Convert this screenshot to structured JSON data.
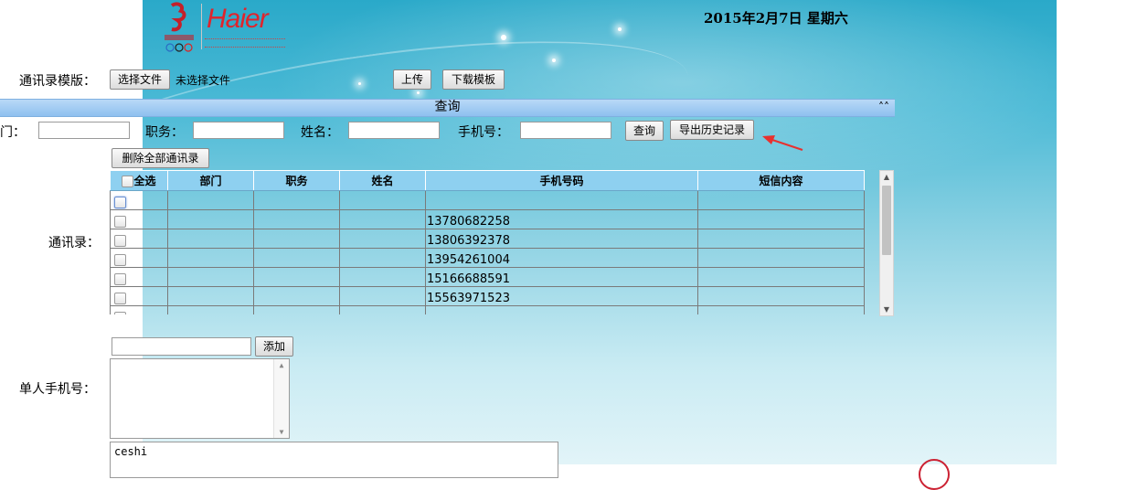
{
  "header": {
    "logo_text": "Haier",
    "logo_caption": "Beijing 2008",
    "date": "2015年2月7日   星期六"
  },
  "template_row": {
    "label": "通讯录模版：",
    "choose_file_button": "选择文件",
    "no_file_text": "未选择文件",
    "upload_button": "上传",
    "download_template_button": "下载模板"
  },
  "query": {
    "bar_title": "查询",
    "collapse_icon": "double-chevron-up",
    "department_label": "部门：",
    "department_value": "",
    "position_label": "职务：",
    "position_value": "",
    "name_label": "姓名：",
    "name_value": "",
    "phone_label": "手机号：",
    "phone_value": "",
    "search_button": "查询",
    "export_history_button": "导出历史记录"
  },
  "contacts": {
    "delete_all_button": "删除全部通讯录",
    "label": "通讯录：",
    "columns": [
      "全选",
      "部门",
      "职务",
      "姓名",
      "手机号码",
      "短信内容"
    ],
    "rows": [
      {
        "department": "",
        "position": "",
        "name": "",
        "phone": "",
        "sms": ""
      },
      {
        "department": "",
        "position": "",
        "name": "",
        "phone": "13780682258",
        "sms": ""
      },
      {
        "department": "",
        "position": "",
        "name": "",
        "phone": "13806392378",
        "sms": ""
      },
      {
        "department": "",
        "position": "",
        "name": "",
        "phone": "13954261004",
        "sms": ""
      },
      {
        "department": "",
        "position": "",
        "name": "",
        "phone": "15166688591",
        "sms": ""
      },
      {
        "department": "",
        "position": "",
        "name": "",
        "phone": "15563971523",
        "sms": ""
      }
    ]
  },
  "single": {
    "input_value": "",
    "add_button": "添加",
    "label": "单人手机号：",
    "list_value": ""
  },
  "message": {
    "content": "ceshi"
  },
  "colors": {
    "header_bar": "#8ec0ef",
    "table_header": "#8ed0f0",
    "annotation_arrow": "#e8312f",
    "logo_red": "#e0242c"
  }
}
